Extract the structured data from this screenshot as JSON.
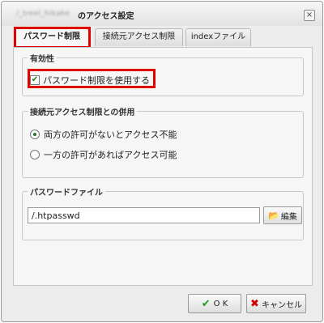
{
  "dialog": {
    "path_blurred": "/_treel_hikake",
    "title": "のアクセス設定",
    "close_glyph": "×"
  },
  "tabs": [
    {
      "label": "パスワード制限",
      "active": true
    },
    {
      "label": "接続元アクセス制限",
      "active": false
    },
    {
      "label": "indexファイル",
      "active": false
    }
  ],
  "validity": {
    "legend": "有効性",
    "checkbox_label": "パスワード制限を使用する",
    "checked": true,
    "check_glyph": "✔"
  },
  "combined": {
    "legend": "接続元アクセス制限との併用",
    "options": [
      {
        "label": "両方の許可がないとアクセス不能",
        "selected": true
      },
      {
        "label": "一方の許可があればアクセス可能",
        "selected": false
      }
    ]
  },
  "password_file": {
    "legend": "パスワードファイル",
    "value": "/.htpasswd",
    "edit_label": "編集",
    "edit_icon": "📂"
  },
  "buttons": {
    "ok_label": "O K",
    "ok_icon": "✔",
    "cancel_label": "キャンセル",
    "cancel_icon": "✖"
  },
  "highlight_color": "#e00000"
}
